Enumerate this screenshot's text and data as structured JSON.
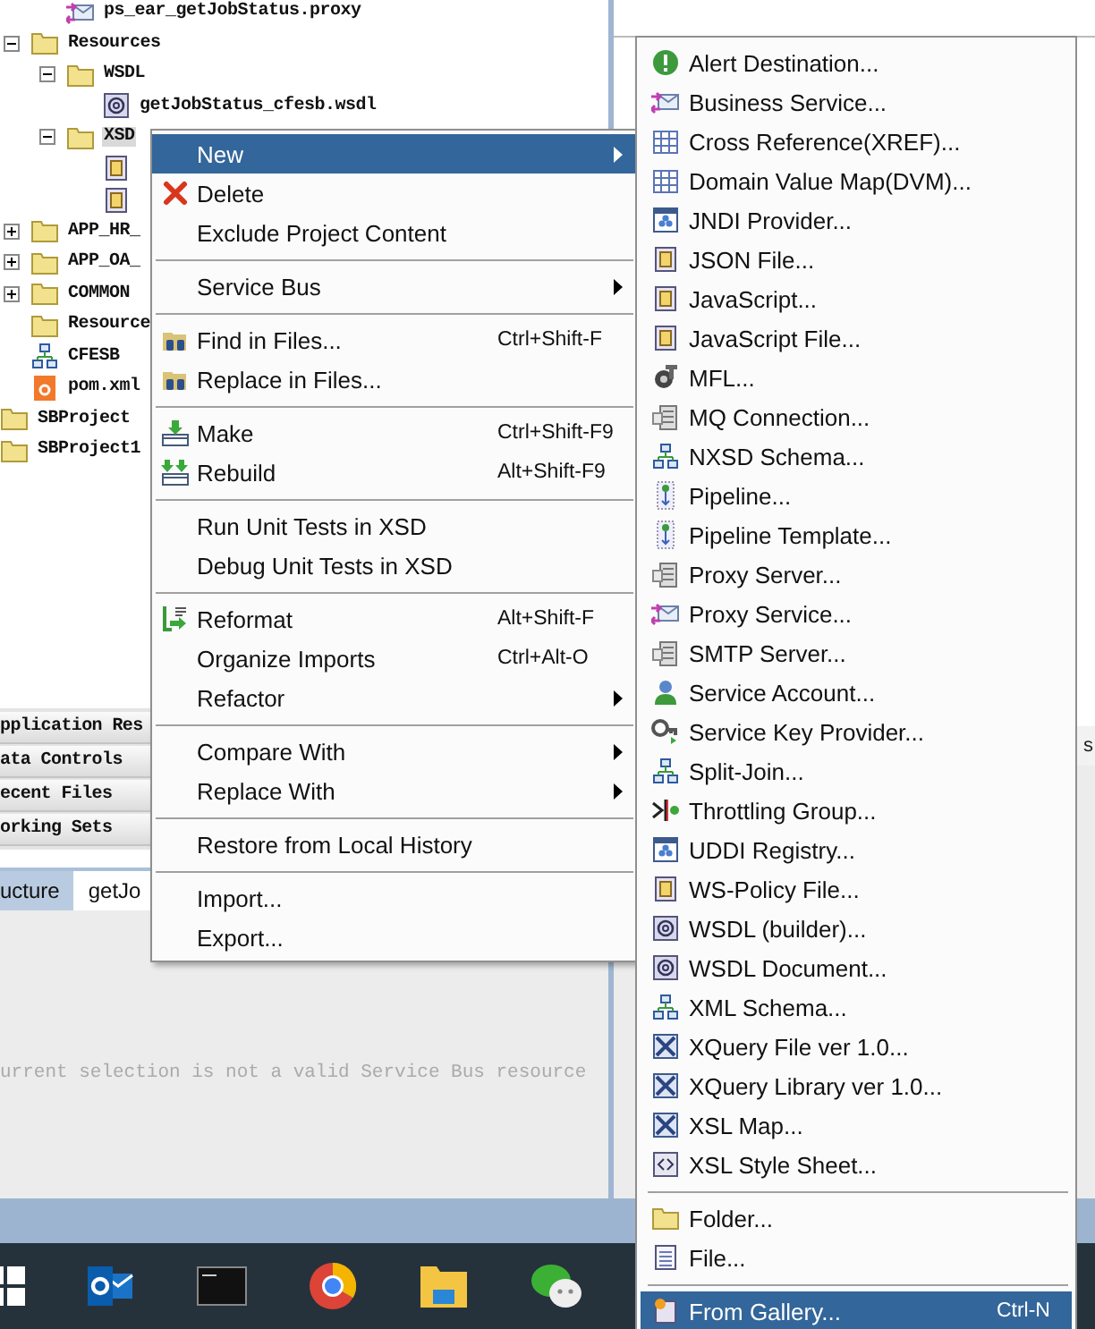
{
  "project_tree": {
    "nodes": [
      {
        "children": [
          {
            "children": [
              {
                "label": "ps_ear_getJobStatus.proxy",
                "kind": "proxy",
                "selected": false
              }
            ]
          },
          {
            "label": "Resources",
            "kind": "folder",
            "expanded": true,
            "selected": false,
            "children": [
              {
                "label": "WSDL",
                "kind": "folder",
                "expanded": true,
                "selected": false,
                "children": [
                  {
                    "label": "getJobStatus_cfesb.wsdl",
                    "kind": "wsdl",
                    "selected": false
                  }
                ]
              },
              {
                "label": "XSD",
                "kind": "folder",
                "expanded": true,
                "selected": true,
                "children": [
                  {
                    "kind": "xsd"
                  },
                  {
                    "kind": "xsd"
                  }
                ]
              }
            ]
          },
          {
            "label": "APP_HR_",
            "kind": "folder",
            "expanded": false,
            "selected": false
          },
          {
            "label": "APP_OA_",
            "kind": "folder",
            "expanded": false,
            "selected": false
          },
          {
            "label": "COMMON",
            "kind": "folder",
            "expanded": false,
            "selected": false
          },
          {
            "label": "Resource",
            "kind": "folder",
            "selected": false
          },
          {
            "label": "CFESB",
            "kind": "composite",
            "selected": false
          },
          {
            "label": "pom.xml",
            "kind": "pom",
            "selected": false
          }
        ]
      },
      {
        "label": "SBProject",
        "kind": "project",
        "selected": false
      },
      {
        "label": "SBProject1",
        "kind": "project",
        "selected": false
      }
    ]
  },
  "navigator_panels": [
    "pplication Res",
    "ata Controls",
    "ecent Files",
    "orking Sets"
  ],
  "tabs": [
    {
      "label": "ucture",
      "selected": false
    },
    {
      "label": "getJo",
      "selected": true
    }
  ],
  "message": "urrent selection is not a valid Service Bus resource",
  "side_panel": {
    "label": "s"
  },
  "context_menu": {
    "groups": [
      [
        {
          "label": "New",
          "selected": true,
          "submenu": true
        },
        {
          "label": "Delete",
          "selected": false,
          "submenu": false
        },
        {
          "label": "Exclude Project Content",
          "selected": false,
          "submenu": false
        }
      ],
      [
        {
          "label": "Service Bus",
          "selected": false,
          "submenu": true
        }
      ],
      [
        {
          "label": "Find in Files...",
          "shortcut": "Ctrl+Shift-F",
          "selected": false,
          "submenu": false
        },
        {
          "label": "Replace in Files...",
          "selected": false,
          "submenu": false
        }
      ],
      [
        {
          "label": "Make",
          "shortcut": "Ctrl+Shift-F9",
          "selected": false,
          "submenu": false
        },
        {
          "label": "Rebuild",
          "shortcut": "Alt+Shift-F9",
          "selected": false,
          "submenu": false
        }
      ],
      [
        {
          "label": "Run Unit Tests in XSD",
          "selected": false,
          "submenu": false
        },
        {
          "label": "Debug Unit Tests in XSD",
          "selected": false,
          "submenu": false
        }
      ],
      [
        {
          "label": "Reformat",
          "shortcut": "Alt+Shift-F",
          "selected": false,
          "submenu": false
        },
        {
          "label": "Organize Imports",
          "shortcut": "Ctrl+Alt-O",
          "selected": false,
          "submenu": false
        },
        {
          "label": "Refactor",
          "selected": false,
          "submenu": true
        }
      ],
      [
        {
          "label": "Compare With",
          "selected": false,
          "submenu": true
        },
        {
          "label": "Replace With",
          "selected": false,
          "submenu": true
        }
      ],
      [
        {
          "label": "Restore from Local History",
          "selected": false,
          "submenu": false
        }
      ],
      [
        {
          "label": "Import...",
          "selected": false,
          "submenu": false
        },
        {
          "label": "Export...",
          "selected": false,
          "submenu": false
        }
      ]
    ]
  },
  "new_submenu": {
    "groups": [
      [
        {
          "label": "Alert Destination...",
          "selected": false
        },
        {
          "label": "Business Service...",
          "selected": false
        },
        {
          "label": "Cross Reference(XREF)...",
          "selected": false
        },
        {
          "label": "Domain Value Map(DVM)...",
          "selected": false
        },
        {
          "label": "JNDI Provider...",
          "selected": false
        },
        {
          "label": "JSON File...",
          "selected": false
        },
        {
          "label": "JavaScript...",
          "selected": false
        },
        {
          "label": "JavaScript File...",
          "selected": false
        },
        {
          "label": "MFL...",
          "selected": false
        },
        {
          "label": "MQ Connection...",
          "selected": false
        },
        {
          "label": "NXSD Schema...",
          "selected": false
        },
        {
          "label": "Pipeline...",
          "selected": false
        },
        {
          "label": "Pipeline Template...",
          "selected": false
        },
        {
          "label": "Proxy Server...",
          "selected": false
        },
        {
          "label": "Proxy Service...",
          "selected": false
        },
        {
          "label": "SMTP Server...",
          "selected": false
        },
        {
          "label": "Service Account...",
          "selected": false
        },
        {
          "label": "Service Key Provider...",
          "selected": false
        },
        {
          "label": "Split-Join...",
          "selected": false
        },
        {
          "label": "Throttling Group...",
          "selected": false
        },
        {
          "label": "UDDI Registry...",
          "selected": false
        },
        {
          "label": "WS-Policy File...",
          "selected": false
        },
        {
          "label": "WSDL (builder)...",
          "selected": false
        },
        {
          "label": "WSDL Document...",
          "selected": false
        },
        {
          "label": "XML Schema...",
          "selected": false
        },
        {
          "label": "XQuery File ver 1.0...",
          "selected": false
        },
        {
          "label": "XQuery Library ver 1.0...",
          "selected": false
        },
        {
          "label": "XSL Map...",
          "selected": false
        },
        {
          "label": "XSL Style Sheet...",
          "selected": false
        }
      ],
      [
        {
          "label": "Folder...",
          "selected": false
        },
        {
          "label": "File...",
          "selected": false
        }
      ],
      [
        {
          "label": "From Gallery...",
          "shortcut": "Ctrl-N",
          "selected": true
        }
      ]
    ]
  }
}
